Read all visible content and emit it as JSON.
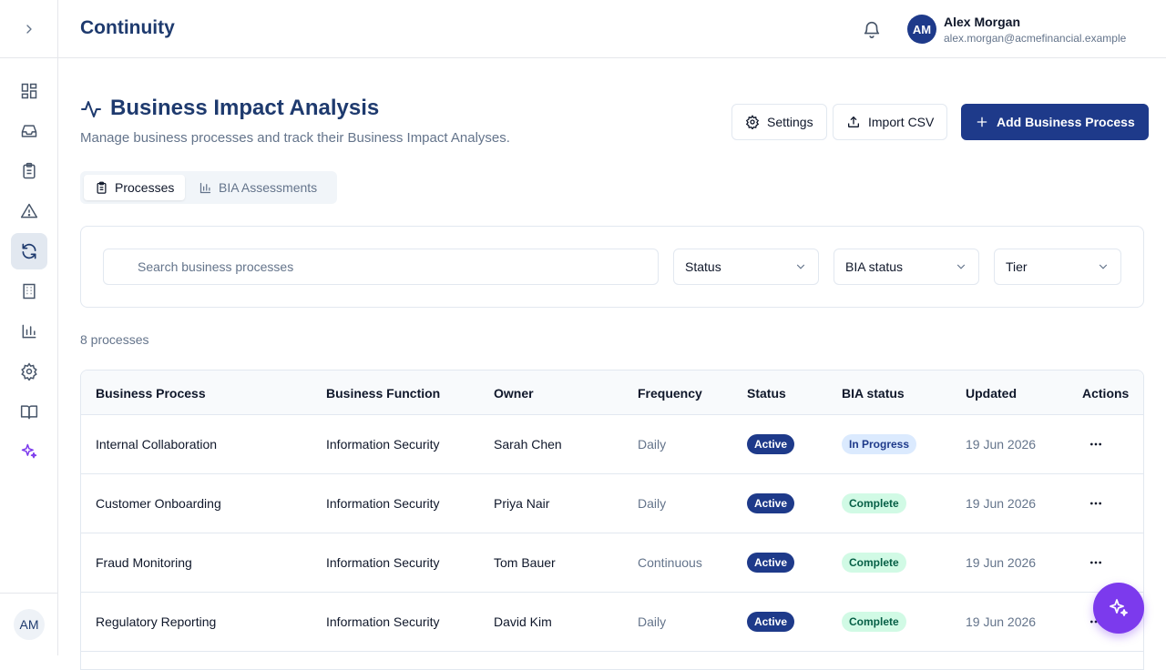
{
  "app": {
    "title": "Continuity"
  },
  "sidebar": {
    "items": [
      {
        "icon": "dashboard-icon"
      },
      {
        "icon": "inbox-icon"
      },
      {
        "icon": "clipboard-icon"
      },
      {
        "icon": "alert-triangle-icon"
      },
      {
        "icon": "refresh-icon",
        "active": true
      },
      {
        "icon": "building-icon"
      },
      {
        "icon": "bar-chart-icon"
      },
      {
        "icon": "gear-icon"
      },
      {
        "icon": "book-icon"
      },
      {
        "icon": "sparkles-icon"
      }
    ],
    "avatar_initials": "AM"
  },
  "user": {
    "initials": "AM",
    "name": "Alex Morgan",
    "email": "alex.morgan@acmefinancial.example"
  },
  "page": {
    "title": "Business Impact Analysis",
    "subtitle": "Manage business processes and track their Business Impact Analyses."
  },
  "actions": {
    "settings": "Settings",
    "import": "Import CSV",
    "add": "Add Business Process"
  },
  "tabs": [
    {
      "label": "Processes",
      "active": true
    },
    {
      "label": "BIA Assessments"
    }
  ],
  "filters": {
    "search_placeholder": "Search business processes",
    "status": "Status",
    "bia_status": "BIA status",
    "tier": "Tier"
  },
  "count_text": "8 processes",
  "table": {
    "headers": [
      "Business Process",
      "Business Function",
      "Owner",
      "Frequency",
      "Status",
      "BIA status",
      "Updated",
      "Actions"
    ],
    "rows": [
      {
        "process": "Internal Collaboration",
        "function": "Information Security",
        "owner": "Sarah Chen",
        "frequency": "Daily",
        "status": "Active",
        "bia": "In Progress",
        "updated": "19 Jun 2026"
      },
      {
        "process": "Customer Onboarding",
        "function": "Information Security",
        "owner": "Priya Nair",
        "frequency": "Daily",
        "status": "Active",
        "bia": "Complete",
        "updated": "19 Jun 2026"
      },
      {
        "process": "Fraud Monitoring",
        "function": "Information Security",
        "owner": "Tom Bauer",
        "frequency": "Continuous",
        "status": "Active",
        "bia": "Complete",
        "updated": "19 Jun 2026"
      },
      {
        "process": "Regulatory Reporting",
        "function": "Information Security",
        "owner": "David Kim",
        "frequency": "Daily",
        "status": "Active",
        "bia": "Complete",
        "updated": "19 Jun 2026"
      }
    ]
  },
  "colors": {
    "brand": "#1e3a8a",
    "fab": "#7c3aed"
  }
}
